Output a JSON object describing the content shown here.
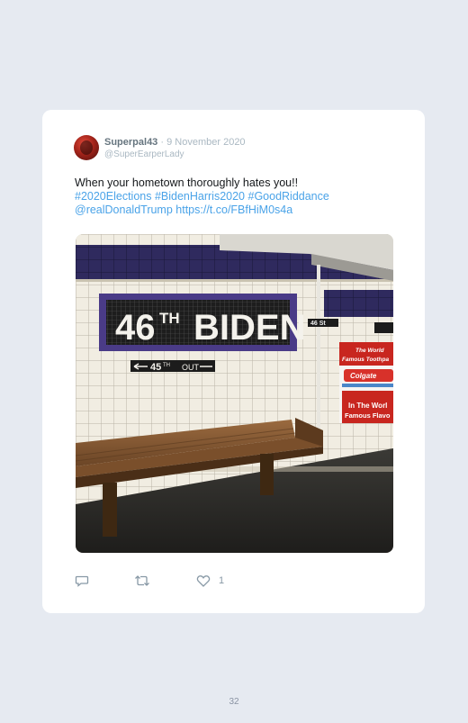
{
  "tweet": {
    "display_name": "Superpal43",
    "separator": "·",
    "date": "9 November 2020",
    "handle": "@SuperEarperLady",
    "text_line1": "When your hometown thoroughly hates you!!",
    "hashtags": "#2020Elections #BidenHarris2020 #GoodRiddance",
    "mention": "@realDonaldTrump",
    "url": "https://t.co/FBfHiM0s4a",
    "like_count": "1"
  },
  "photo": {
    "sign_number": "46",
    "sign_suffix": "TH",
    "sign_name": "BIDEN",
    "exit_number": "45",
    "exit_suffix": "TH",
    "exit_label": "OUT",
    "ad_line1": "The World",
    "ad_line2": "Famous Toothpa",
    "ad_brand": "Colgate",
    "ad_line3": "In The Worl",
    "ad_line4": "Famous Flavo",
    "small_sign": "46 St"
  },
  "page": {
    "number": "32"
  },
  "icons": [
    "reply-icon",
    "retweet-icon",
    "like-icon"
  ],
  "colors": {
    "link": "#4aa3e8",
    "background": "#e6eaf1",
    "card": "#ffffff"
  }
}
